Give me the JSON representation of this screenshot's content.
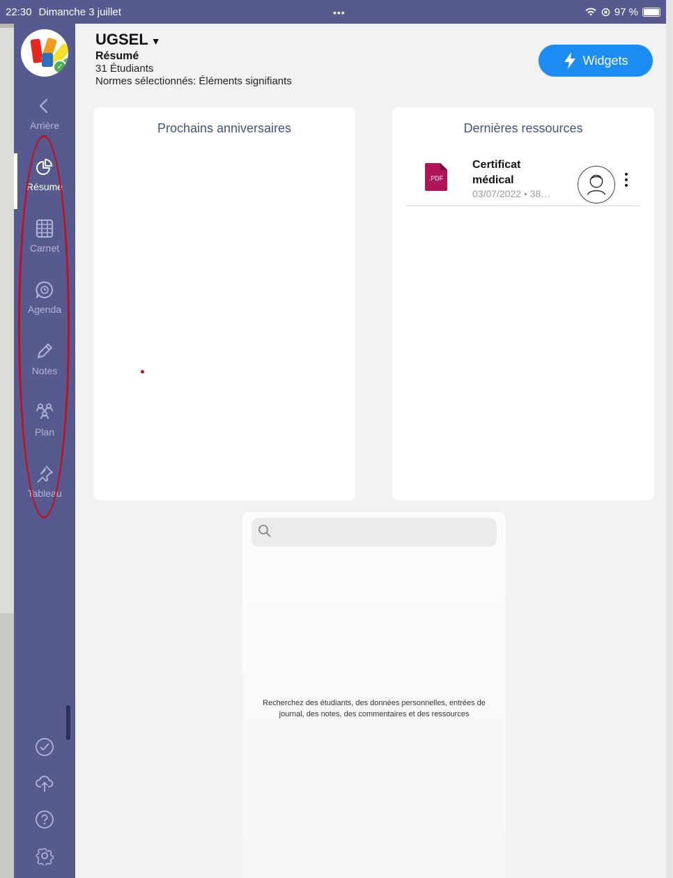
{
  "statusbar": {
    "time": "22:30",
    "date": "Dimanche 3 juillet",
    "battery": "97 %"
  },
  "sidebar": {
    "items": [
      {
        "label": "Arrière",
        "icon": "back-chevron-icon"
      },
      {
        "label": "Résumé",
        "icon": "pie-chart-icon",
        "active": true
      },
      {
        "label": "Carnet",
        "icon": "grid-icon"
      },
      {
        "label": "Agenda",
        "icon": "clock-bubble-icon"
      },
      {
        "label": "Notes",
        "icon": "pencil-icon"
      },
      {
        "label": "Plan",
        "icon": "people-icon"
      },
      {
        "label": "Tableau",
        "icon": "pin-icon"
      }
    ],
    "bottom_icons": [
      "check-circle-icon",
      "cloud-upload-icon",
      "help-icon",
      "settings-icon"
    ]
  },
  "header": {
    "title": "UGSEL",
    "subtitle": "Résumé",
    "students": "31 Étudiants",
    "norms": "Normes sélectionnés: Éléments signifiants"
  },
  "widgets_button": {
    "label": "Widgets"
  },
  "birthdays_card": {
    "title": "Prochains anniversaires"
  },
  "resources_card": {
    "title": "Dernières ressources",
    "items": [
      {
        "name": "Certificat médical",
        "meta": "03/07/2022 • 38…",
        "type": "PDF",
        "badge": ".PDF"
      }
    ]
  },
  "search": {
    "placeholder": "",
    "hint": "Recherchez des étudiants, des données personnelles, entrées de journal, des notes, des commentaires et des ressources"
  },
  "colors": {
    "sidebar": "#575a8f",
    "accent": "#1b8df2",
    "pdf": "#b0155a",
    "annotation": "#c40f1c"
  }
}
